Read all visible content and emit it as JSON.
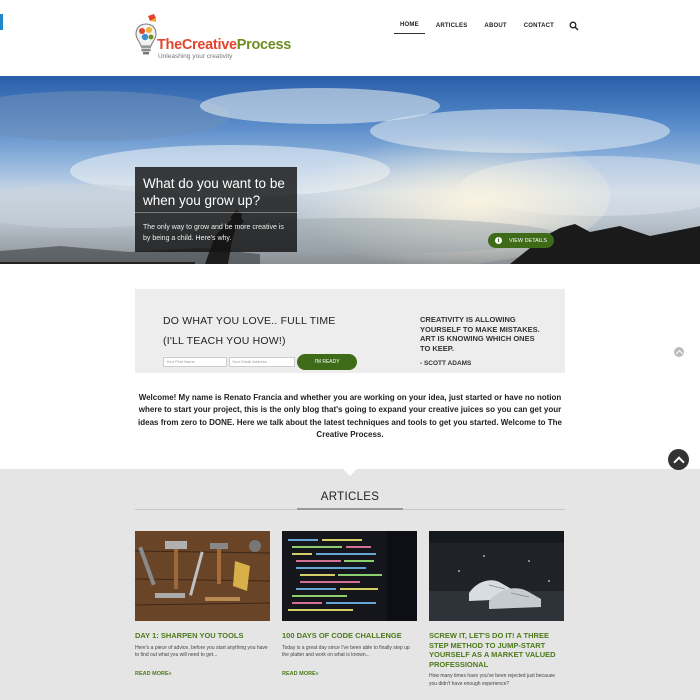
{
  "header": {
    "logo_title_part1": "The",
    "logo_title_part2": "Creative",
    "logo_title_part3": "Process",
    "logo_tagline": "Unleashing your creativity",
    "nav": [
      {
        "label": "HOME",
        "active": true
      },
      {
        "label": "ARTICLES",
        "active": false
      },
      {
        "label": "ABOUT",
        "active": false
      },
      {
        "label": "CONTACT",
        "active": false
      }
    ],
    "search_icon": "search-icon"
  },
  "hero": {
    "title": "What do you want to be when you grow up?",
    "subtitle": "The only way to grow and be more creative is by being a child. Here's why.",
    "button_label": "VIEW DETAILS",
    "button_icon": "info-icon"
  },
  "optin": {
    "heading_line1": "DO WHAT YOU LOVE.. FULL TIME",
    "heading_line2": "(I'LL TEACH YOU HOW!)",
    "first_name_placeholder": "Your First Name",
    "email_placeholder": "Your Email Address",
    "button_label": "I'M READY",
    "quote": "CREATIVITY IS ALLOWING YOURSELF TO MAKE MISTAKES. ART IS KNOWING WHICH ONES TO KEEP.",
    "quote_author": "- SCOTT ADAMS"
  },
  "welcome": {
    "text": "Welcome! My name is Renato Francia and whether you are working on your idea, just started or have no notion where to start your project, this is the only blog that's going to expand your creative juices so you can get your ideas from zero to DONE. Here we talk about the latest techniques and tools to get you started. Welcome to The Creative Process."
  },
  "articles": {
    "section_title": "ARTICLES",
    "items": [
      {
        "title": "DAY 1: SHARPEN YOU TOOLS",
        "excerpt": "Here's a piece of advice, before you start anything you have to find out what you will need to get...",
        "read_more": "READ MORE»"
      },
      {
        "title": "100 DAYS OF CODE CHALLENGE",
        "excerpt": "Today is a great day since I've been able to finally step up the platter and work on what is known...",
        "read_more": "READ MORE»"
      },
      {
        "title": "SCREW IT, LET'S DO IT! A THREE STEP METHOD TO JUMP-START YOURSELF AS A MARKET VALUED PROFESSIONAL",
        "excerpt": "How many times have you've been rejected just because you didn't have enough experience?",
        "read_more": ""
      }
    ]
  },
  "colors": {
    "brand_green": "#3d6b18",
    "link_green": "#4d7a1a",
    "brand_red": "#e2452e"
  }
}
